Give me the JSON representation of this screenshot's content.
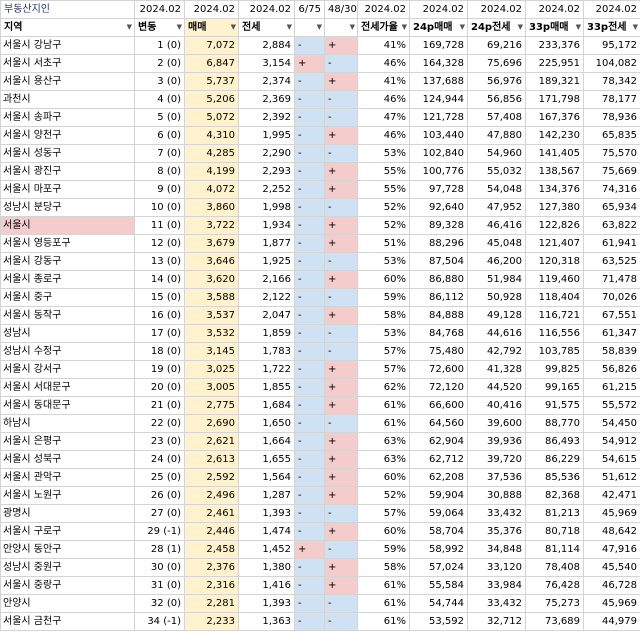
{
  "sheet": {
    "title": "부동산지인",
    "dates": [
      "2024.02",
      "2024.02",
      "2024.02",
      "6/75",
      "48/30",
      "2024.02",
      "2024.02",
      "2024.02",
      "2024.02",
      "2024.02"
    ],
    "headers": [
      "지역",
      "변동",
      "매매",
      "전세",
      "",
      "",
      "전세가율",
      "24p매매",
      "24p전세",
      "33p매매",
      "33p전세"
    ]
  },
  "rows": [
    {
      "region": "서울시 강남구",
      "rank": "1 (0)",
      "sale": "7,072",
      "jeonse": "2,884",
      "s1": "-",
      "s2": "+",
      "ratio": "41%",
      "p24s": "169,728",
      "p24j": "69,216",
      "p33s": "233,376",
      "p33j": "95,172"
    },
    {
      "region": "서울시 서초구",
      "rank": "2 (0)",
      "sale": "6,847",
      "jeonse": "3,154",
      "s1": "+",
      "s2": "-",
      "ratio": "46%",
      "p24s": "164,328",
      "p24j": "75,696",
      "p33s": "225,951",
      "p33j": "104,082"
    },
    {
      "region": "서울시 용산구",
      "rank": "3 (0)",
      "sale": "5,737",
      "jeonse": "2,374",
      "s1": "-",
      "s2": "+",
      "ratio": "41%",
      "p24s": "137,688",
      "p24j": "56,976",
      "p33s": "189,321",
      "p33j": "78,342"
    },
    {
      "region": "과천시",
      "rank": "4 (0)",
      "sale": "5,206",
      "jeonse": "2,369",
      "s1": "-",
      "s2": "-",
      "ratio": "46%",
      "p24s": "124,944",
      "p24j": "56,856",
      "p33s": "171,798",
      "p33j": "78,177"
    },
    {
      "region": "서울시 송파구",
      "rank": "5 (0)",
      "sale": "5,072",
      "jeonse": "2,392",
      "s1": "-",
      "s2": "-",
      "ratio": "47%",
      "p24s": "121,728",
      "p24j": "57,408",
      "p33s": "167,376",
      "p33j": "78,936"
    },
    {
      "region": "서울시 양천구",
      "rank": "6 (0)",
      "sale": "4,310",
      "jeonse": "1,995",
      "s1": "-",
      "s2": "+",
      "ratio": "46%",
      "p24s": "103,440",
      "p24j": "47,880",
      "p33s": "142,230",
      "p33j": "65,835"
    },
    {
      "region": "서울시 성동구",
      "rank": "7 (0)",
      "sale": "4,285",
      "jeonse": "2,290",
      "s1": "-",
      "s2": "-",
      "ratio": "53%",
      "p24s": "102,840",
      "p24j": "54,960",
      "p33s": "141,405",
      "p33j": "75,570"
    },
    {
      "region": "서울시 광진구",
      "rank": "8 (0)",
      "sale": "4,199",
      "jeonse": "2,293",
      "s1": "-",
      "s2": "+",
      "ratio": "55%",
      "p24s": "100,776",
      "p24j": "55,032",
      "p33s": "138,567",
      "p33j": "75,669"
    },
    {
      "region": "서울시 마포구",
      "rank": "9 (0)",
      "sale": "4,072",
      "jeonse": "2,252",
      "s1": "-",
      "s2": "+",
      "ratio": "55%",
      "p24s": "97,728",
      "p24j": "54,048",
      "p33s": "134,376",
      "p33j": "74,316"
    },
    {
      "region": "성남시 분당구",
      "rank": "10 (0)",
      "sale": "3,860",
      "jeonse": "1,998",
      "s1": "-",
      "s2": "-",
      "ratio": "52%",
      "p24s": "92,640",
      "p24j": "47,952",
      "p33s": "127,380",
      "p33j": "65,934"
    },
    {
      "region": "서울시",
      "rank": "11 (0)",
      "sale": "3,722",
      "jeonse": "1,934",
      "s1": "-",
      "s2": "+",
      "ratio": "52%",
      "p24s": "89,328",
      "p24j": "46,416",
      "p33s": "122,826",
      "p33j": "63,822"
    },
    {
      "region": "서울시 영등포구",
      "rank": "12 (0)",
      "sale": "3,679",
      "jeonse": "1,877",
      "s1": "-",
      "s2": "+",
      "ratio": "51%",
      "p24s": "88,296",
      "p24j": "45,048",
      "p33s": "121,407",
      "p33j": "61,941"
    },
    {
      "region": "서울시 강동구",
      "rank": "13 (0)",
      "sale": "3,646",
      "jeonse": "1,925",
      "s1": "-",
      "s2": "-",
      "ratio": "53%",
      "p24s": "87,504",
      "p24j": "46,200",
      "p33s": "120,318",
      "p33j": "63,525"
    },
    {
      "region": "서울시 종로구",
      "rank": "14 (0)",
      "sale": "3,620",
      "jeonse": "2,166",
      "s1": "-",
      "s2": "+",
      "ratio": "60%",
      "p24s": "86,880",
      "p24j": "51,984",
      "p33s": "119,460",
      "p33j": "71,478"
    },
    {
      "region": "서울시 중구",
      "rank": "15 (0)",
      "sale": "3,588",
      "jeonse": "2,122",
      "s1": "-",
      "s2": "-",
      "ratio": "59%",
      "p24s": "86,112",
      "p24j": "50,928",
      "p33s": "118,404",
      "p33j": "70,026"
    },
    {
      "region": "서울시 동작구",
      "rank": "16 (0)",
      "sale": "3,537",
      "jeonse": "2,047",
      "s1": "-",
      "s2": "+",
      "ratio": "58%",
      "p24s": "84,888",
      "p24j": "49,128",
      "p33s": "116,721",
      "p33j": "67,551"
    },
    {
      "region": "성남시",
      "rank": "17 (0)",
      "sale": "3,532",
      "jeonse": "1,859",
      "s1": "-",
      "s2": "-",
      "ratio": "53%",
      "p24s": "84,768",
      "p24j": "44,616",
      "p33s": "116,556",
      "p33j": "61,347"
    },
    {
      "region": "성남시 수정구",
      "rank": "18 (0)",
      "sale": "3,145",
      "jeonse": "1,783",
      "s1": "-",
      "s2": "-",
      "ratio": "57%",
      "p24s": "75,480",
      "p24j": "42,792",
      "p33s": "103,785",
      "p33j": "58,839"
    },
    {
      "region": "서울시 강서구",
      "rank": "19 (0)",
      "sale": "3,025",
      "jeonse": "1,722",
      "s1": "-",
      "s2": "+",
      "ratio": "57%",
      "p24s": "72,600",
      "p24j": "41,328",
      "p33s": "99,825",
      "p33j": "56,826"
    },
    {
      "region": "서울시 서대문구",
      "rank": "20 (0)",
      "sale": "3,005",
      "jeonse": "1,855",
      "s1": "-",
      "s2": "+",
      "ratio": "62%",
      "p24s": "72,120",
      "p24j": "44,520",
      "p33s": "99,165",
      "p33j": "61,215"
    },
    {
      "region": "서울시 동대문구",
      "rank": "21 (0)",
      "sale": "2,775",
      "jeonse": "1,684",
      "s1": "-",
      "s2": "+",
      "ratio": "61%",
      "p24s": "66,600",
      "p24j": "40,416",
      "p33s": "91,575",
      "p33j": "55,572"
    },
    {
      "region": "하남시",
      "rank": "22 (0)",
      "sale": "2,690",
      "jeonse": "1,650",
      "s1": "-",
      "s2": "-",
      "ratio": "61%",
      "p24s": "64,560",
      "p24j": "39,600",
      "p33s": "88,770",
      "p33j": "54,450"
    },
    {
      "region": "서울시 은평구",
      "rank": "23 (0)",
      "sale": "2,621",
      "jeonse": "1,664",
      "s1": "-",
      "s2": "+",
      "ratio": "63%",
      "p24s": "62,904",
      "p24j": "39,936",
      "p33s": "86,493",
      "p33j": "54,912"
    },
    {
      "region": "서울시 성북구",
      "rank": "24 (0)",
      "sale": "2,613",
      "jeonse": "1,655",
      "s1": "-",
      "s2": "+",
      "ratio": "63%",
      "p24s": "62,712",
      "p24j": "39,720",
      "p33s": "86,229",
      "p33j": "54,615"
    },
    {
      "region": "서울시 관악구",
      "rank": "25 (0)",
      "sale": "2,592",
      "jeonse": "1,564",
      "s1": "-",
      "s2": "+",
      "ratio": "60%",
      "p24s": "62,208",
      "p24j": "37,536",
      "p33s": "85,536",
      "p33j": "51,612"
    },
    {
      "region": "서울시 노원구",
      "rank": "26 (0)",
      "sale": "2,496",
      "jeonse": "1,287",
      "s1": "-",
      "s2": "+",
      "ratio": "52%",
      "p24s": "59,904",
      "p24j": "30,888",
      "p33s": "82,368",
      "p33j": "42,471"
    },
    {
      "region": "광명시",
      "rank": "27 (0)",
      "sale": "2,461",
      "jeonse": "1,393",
      "s1": "-",
      "s2": "-",
      "ratio": "57%",
      "p24s": "59,064",
      "p24j": "33,432",
      "p33s": "81,213",
      "p33j": "45,969"
    },
    {
      "region": "서울시 구로구",
      "rank": "29 (-1)",
      "sale": "2,446",
      "jeonse": "1,474",
      "s1": "-",
      "s2": "+",
      "ratio": "60%",
      "p24s": "58,704",
      "p24j": "35,376",
      "p33s": "80,718",
      "p33j": "48,642"
    },
    {
      "region": "안양시 동안구",
      "rank": "28 (1)",
      "sale": "2,458",
      "jeonse": "1,452",
      "s1": "+",
      "s2": "-",
      "ratio": "59%",
      "p24s": "58,992",
      "p24j": "34,848",
      "p33s": "81,114",
      "p33j": "47,916"
    },
    {
      "region": "성남시 중원구",
      "rank": "30 (0)",
      "sale": "2,376",
      "jeonse": "1,380",
      "s1": "-",
      "s2": "+",
      "ratio": "58%",
      "p24s": "57,024",
      "p24j": "33,120",
      "p33s": "78,408",
      "p33j": "45,540"
    },
    {
      "region": "서울시 중랑구",
      "rank": "31 (0)",
      "sale": "2,316",
      "jeonse": "1,416",
      "s1": "-",
      "s2": "+",
      "ratio": "61%",
      "p24s": "55,584",
      "p24j": "33,984",
      "p33s": "76,428",
      "p33j": "46,728"
    },
    {
      "region": "안양시",
      "rank": "32 (0)",
      "sale": "2,281",
      "jeonse": "1,393",
      "s1": "-",
      "s2": "-",
      "ratio": "61%",
      "p24s": "54,744",
      "p24j": "33,432",
      "p33s": "75,273",
      "p33j": "45,969"
    },
    {
      "region": "서울시 금천구",
      "rank": "34 (-1)",
      "sale": "2,233",
      "jeonse": "1,363",
      "s1": "-",
      "s2": "-",
      "ratio": "61%",
      "p24s": "53,592",
      "p24j": "32,712",
      "p33s": "73,689",
      "p33j": "44,979"
    }
  ],
  "colors": {
    "yellow": "#fff2cc",
    "blue": "#cfe2f3",
    "pink": "#f4cccc"
  }
}
